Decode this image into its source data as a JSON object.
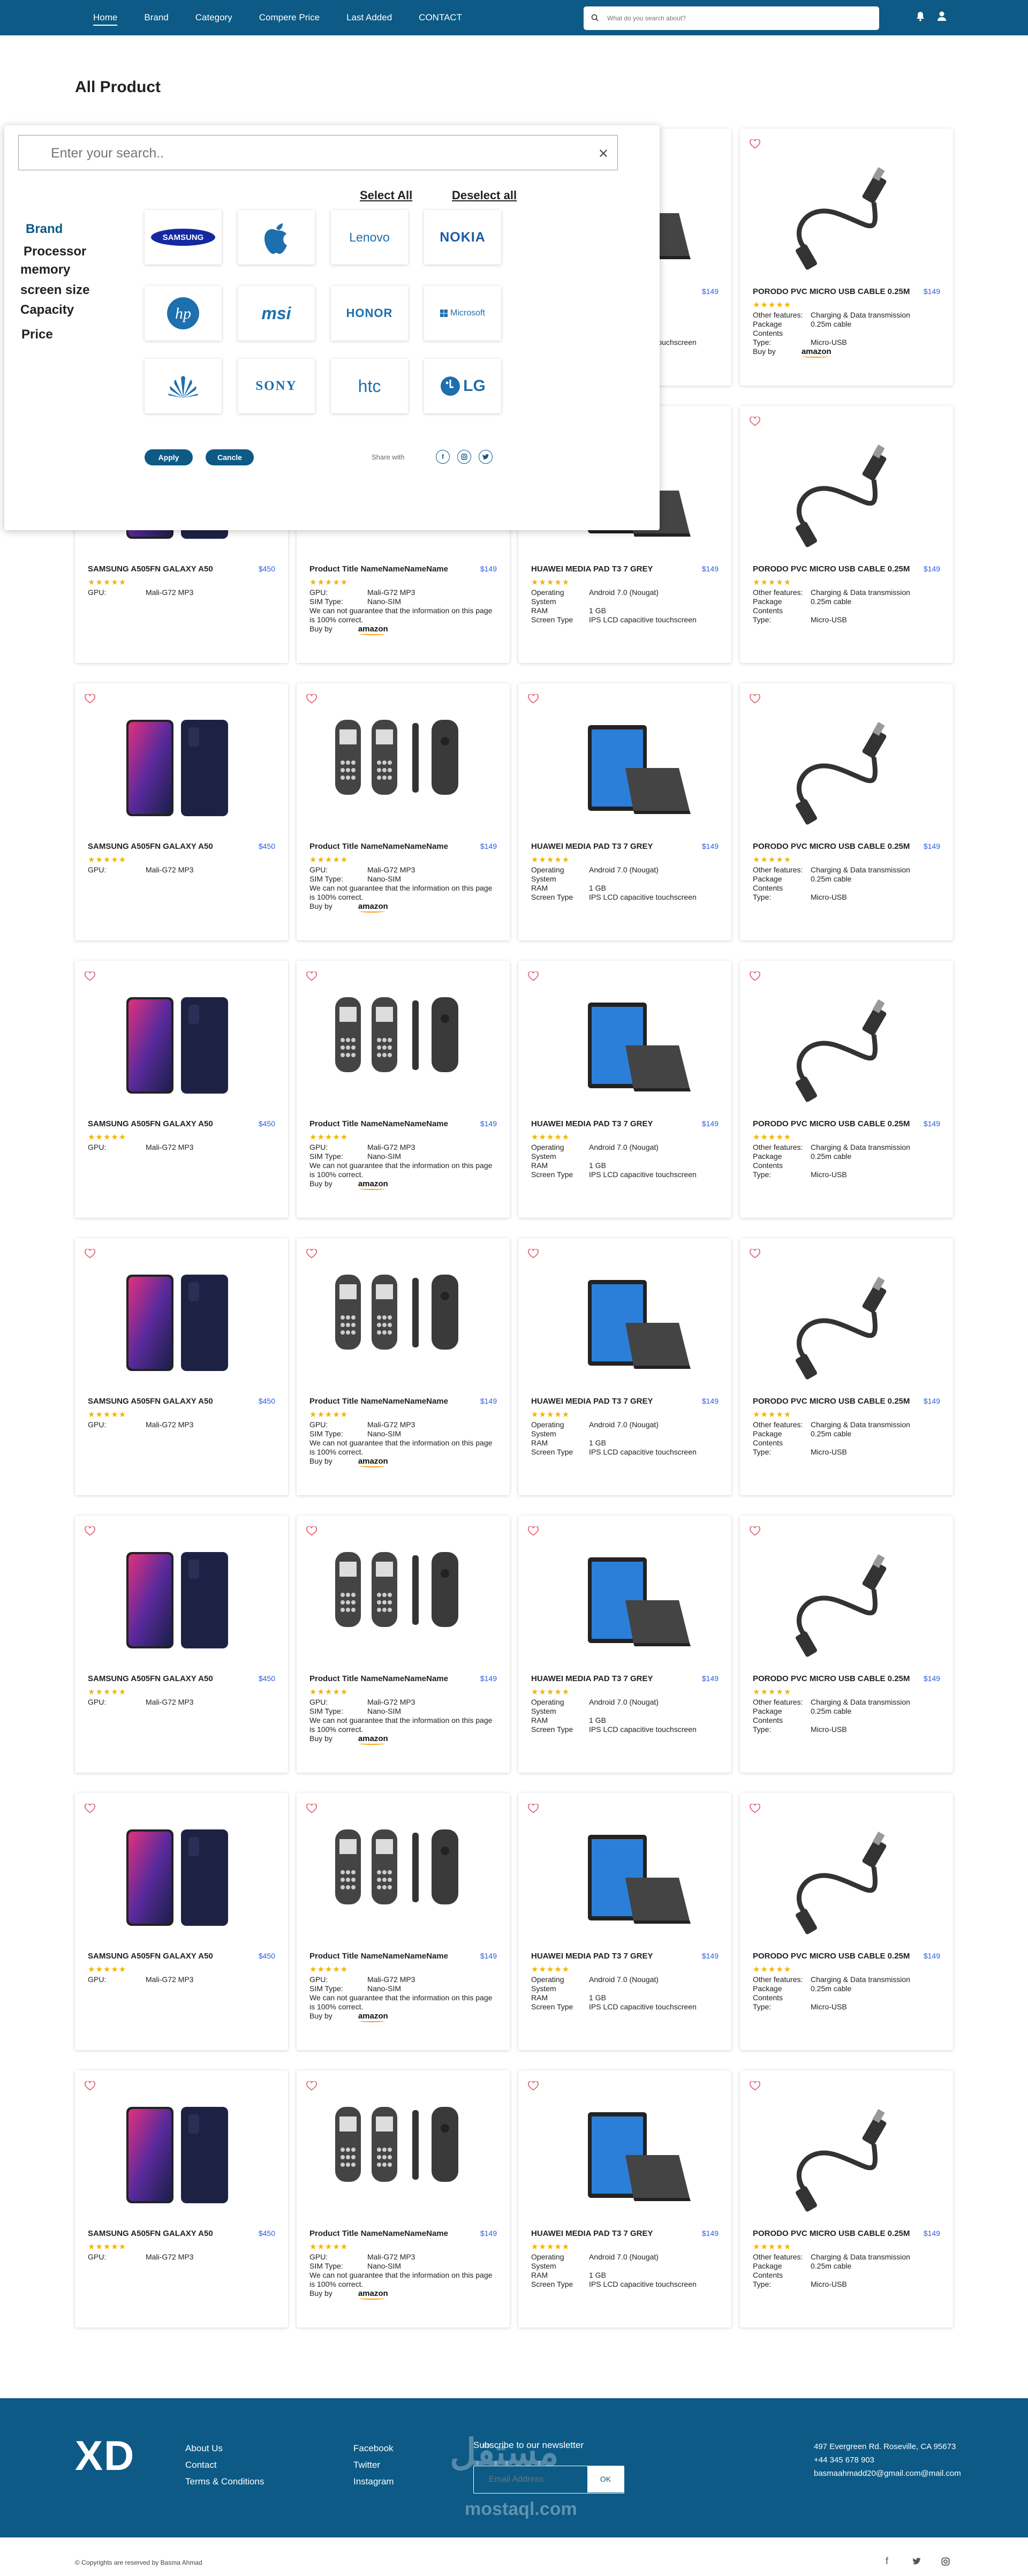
{
  "nav": {
    "links": [
      "Home",
      "Brand",
      "Category",
      "Compere Price",
      "Last Added",
      "CONTACT"
    ],
    "search_placeholder": "What do you search about?",
    "icons": [
      "bell-icon",
      "user-icon"
    ]
  },
  "page_title": "All Product",
  "filter": {
    "search_placeholder": "Enter your search..",
    "select_all": "Select All",
    "deselect_all": "Deselect all",
    "categories": [
      "Brand",
      "Processor",
      "memory",
      "screen size",
      "Capacity",
      "Price"
    ],
    "brands": [
      "SAMSUNG",
      "Apple",
      "Lenovo",
      "NOKIA",
      "hp",
      "msi",
      "HONOR",
      "Microsoft",
      "HUAWEI",
      "SONY",
      "htc",
      "LG"
    ],
    "apply": "Apply",
    "cancel": "Cancle",
    "share_with": "Share with",
    "social": [
      "f",
      "ig",
      "tw"
    ]
  },
  "products": {
    "samsung": {
      "name": "SAMSUNG A505FN GALAXY A50",
      "price": "$450",
      "stars": "★★★★★",
      "specs": [
        [
          "GPU:",
          "Mali-G72 MP3"
        ]
      ]
    },
    "nokia": {
      "name": "Product Title NameNameNameName",
      "price": "$149",
      "stars": "★★★★★",
      "specs": [
        [
          "GPU:",
          "Mali-G72 MP3"
        ],
        [
          "SIM Type:",
          "Nano-SIM"
        ]
      ],
      "note": "We can not guarantee that the information on this page is 100% correct.",
      "buy": "Buy by",
      "amazon": "amazon"
    },
    "huawei": {
      "name": "HUAWEI MEDIA PAD T3 7 GREY",
      "price": "$149",
      "stars": "★★★★★",
      "specs": [
        [
          "Operating System",
          "Android 7.0 (Nougat)"
        ],
        [
          "RAM",
          "1 GB"
        ],
        [
          "Screen Type",
          "IPS LCD capacitive touchscreen"
        ]
      ]
    },
    "cable": {
      "name": "PORODO PVC MICRO USB CABLE 0.25M",
      "price": "$149",
      "stars": "★★★★★",
      "specs": [
        [
          "Other features:",
          "Charging & Data transmission"
        ],
        [
          "Package Contents",
          "0.25m cable"
        ],
        [
          "Type:",
          "Micro-USB"
        ]
      ]
    },
    "cable_first": {
      "specs": [
        [
          "Other features:",
          "Charging & Data transmission"
        ],
        [
          "Package Contents",
          "0.25m cable"
        ],
        [
          "Type:",
          "Micro-USB"
        ]
      ],
      "buy": "Buy by",
      "amazon": "amazon"
    }
  },
  "footer": {
    "logo": "XD",
    "col1": [
      "About Us",
      "Contact",
      "Terms & Conditions"
    ],
    "col2": [
      "Facebook",
      "Twitter",
      "Instagram"
    ],
    "newsletter": "Subscribe to our newsletter",
    "email_placeholder": "Email Address",
    "ok": "OK",
    "contact": [
      "497 Evergreen Rd. Roseville, CA 95673",
      "+44 345 678 903",
      "basmaahmadd20@gmail.com@mail.com"
    ],
    "copyright": "© Copyrights are reserved by Basma Ahmad",
    "watermark": "مستقل",
    "watermark2": "mostaql.com"
  },
  "colors": {
    "primary": "#0c5a85",
    "price": "#2b5de0",
    "stars": "#f4b400",
    "heart": "#e0566a"
  }
}
